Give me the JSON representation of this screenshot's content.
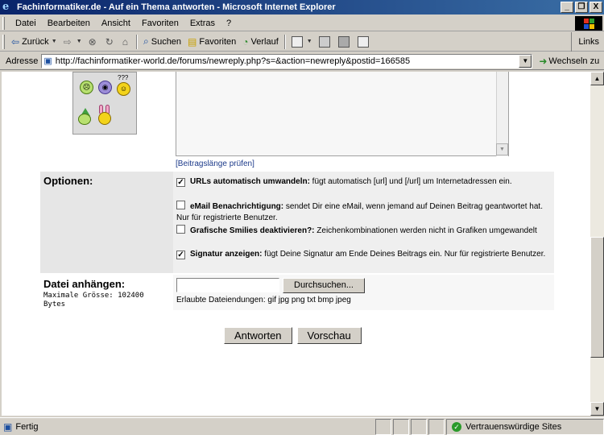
{
  "window": {
    "title": "Fachinformatiker.de - Auf ein Thema antworten - Microsoft Internet Explorer",
    "minimize": "_",
    "maximize": "❐",
    "close": "X"
  },
  "menu": {
    "items": [
      "Datei",
      "Bearbeiten",
      "Ansicht",
      "Favoriten",
      "Extras",
      "?"
    ]
  },
  "toolbar": {
    "back": "Zurück",
    "search": "Suchen",
    "favorites": "Favoriten",
    "history": "Verlauf",
    "links": "Links"
  },
  "address": {
    "label": "Adresse",
    "url": "http://fachinformatiker-world.de/forums/newreply.php?s=&action=newreply&postid=166585",
    "go": "Wechseln zu"
  },
  "form": {
    "check_length": "[Beitragslänge prüfen]",
    "options_label": "Optionen:",
    "options": [
      {
        "title": "URLs automatisch umwandeln:",
        "desc": " fügt automatisch [url] und [/url] um Internetadressen ein.",
        "checked": "✓"
      },
      {
        "title": "eMail Benachrichtigung:",
        "desc": " sendet Dir eine eMail, wenn jemand auf Deinen Beitrag geantwortet hat. Nur für registrierte Benutzer.",
        "checked": ""
      },
      {
        "title": "Grafische Smilies deaktivieren?:",
        "desc": " Zeichenkombinationen werden nicht in Grafiken umgewandelt",
        "checked": ""
      },
      {
        "title": "Signatur anzeigen:",
        "desc": " fügt Deine Signatur am Ende Deines Beitrags ein. Nur für registrierte Benutzer.",
        "checked": "✓"
      }
    ],
    "attach_label": "Datei anhängen:",
    "attach_max": "Maximale Grösse: 102400 Bytes",
    "browse": "Durchsuchen...",
    "allowed": "Erlaubte Dateiendungen: gif jpg png txt bmp jpeg",
    "submit": "Antworten",
    "preview": "Vorschau"
  },
  "smilies": {
    "question": "???"
  },
  "status": {
    "text": "Fertig",
    "zone": "Vertrauenswürdige Sites"
  },
  "colors": {
    "titlebar_start": "#0a246a",
    "titlebar_end": "#3a6ea5",
    "chrome": "#d4d0c8",
    "link": "#1c3a8a"
  }
}
